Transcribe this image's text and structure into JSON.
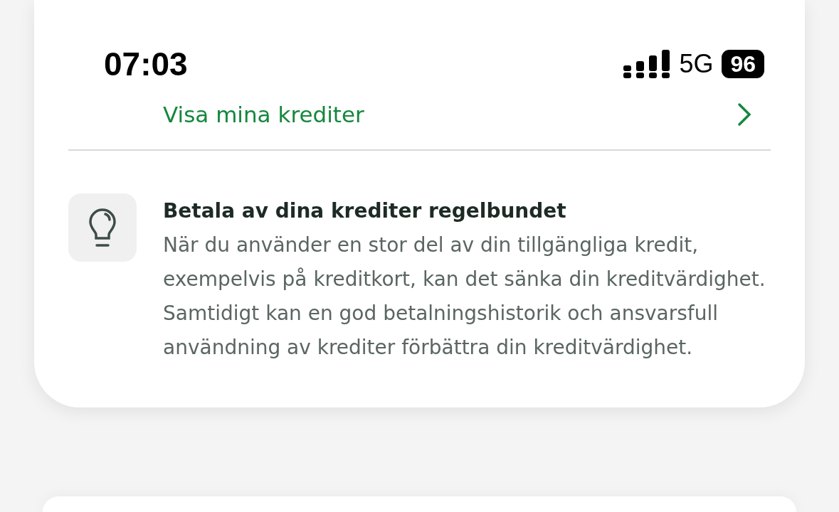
{
  "status_bar": {
    "time": "07:03",
    "network": "5G",
    "battery": "96"
  },
  "credits_link": {
    "label": "Visa mina krediter"
  },
  "tip": {
    "title": "Betala av dina krediter regelbundet",
    "body": "När du använder en stor del av din tillgängliga kredit, exempelvis på kreditkort, kan det sänka din kreditvärdighet. Samtidigt kan en god betalningshistorik och ansvarsfull användning av krediter förbättra din kreditvärdighet."
  }
}
